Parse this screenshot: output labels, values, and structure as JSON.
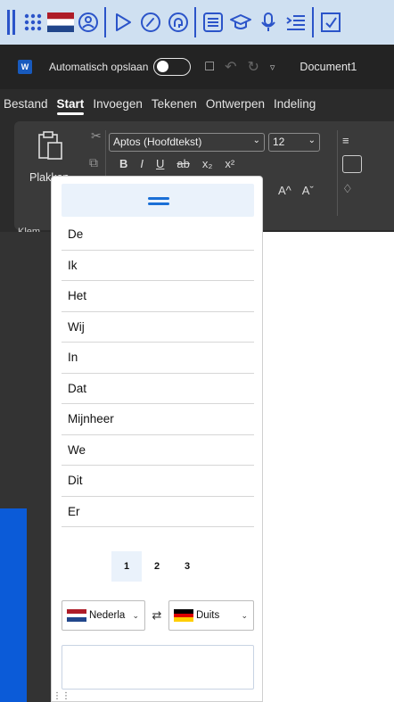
{
  "toolbar": {
    "icons": [
      "drag-handle-icon",
      "keypad-icon",
      "netherlands-flag-icon",
      "speech-face-icon",
      "play-icon",
      "speed-gauge-icon",
      "speech-head-icon",
      "list-icon",
      "graduation-cap-icon",
      "microphone-icon",
      "indent-list-icon",
      "screen-capture-icon"
    ]
  },
  "titlebar": {
    "app_logo": "W",
    "autosave_label": "Automatisch opslaan",
    "document_title": "Document1"
  },
  "ribbon": {
    "tabs": [
      "Bestand",
      "Start",
      "Invoegen",
      "Tekenen",
      "Ontwerpen",
      "Indeling"
    ],
    "active_tab": "Start",
    "paste_label": "Plakken",
    "clipboard_group_label": "Klem",
    "font_name": "Aptos (Hoofdtekst)",
    "font_size": "12",
    "format_buttons": [
      "B",
      "I",
      "U",
      "ab",
      "x₂",
      "x²"
    ],
    "font_grow": "A^",
    "font_shrink": "Aˇ"
  },
  "prediction_panel": {
    "words": [
      "De",
      "Ik",
      "Het",
      "Wij",
      "In",
      "Dat",
      "Mijnheer",
      "We",
      "Dit",
      "Er"
    ],
    "pages": [
      "1",
      "2",
      "3"
    ],
    "active_page": "1",
    "source_language": "Nederla",
    "target_language": "Duits",
    "swap_symbol": "⇄"
  },
  "colors": {
    "accent": "#1a6fd6",
    "toolbar_bg": "#cfe0f1",
    "toolbar_icon": "#2b54c9",
    "word_blue": "#185abd"
  }
}
